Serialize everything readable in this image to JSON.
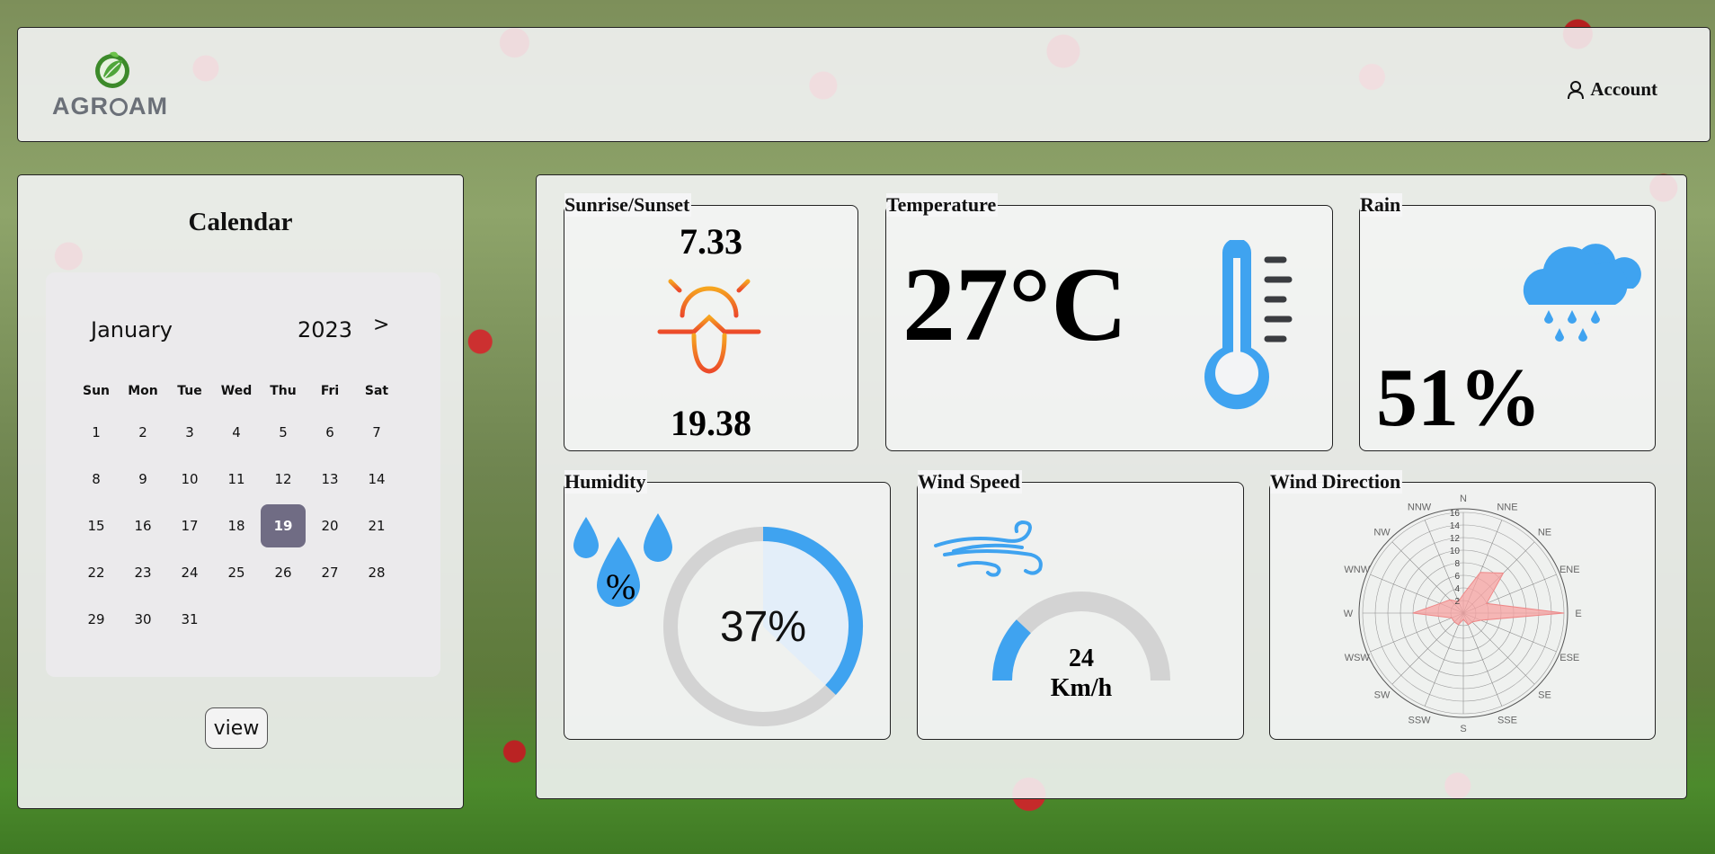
{
  "header": {
    "logo_text": "AGRAM",
    "logo_text_pre": "AGR",
    "logo_text_post": "AM",
    "account_label": "Account"
  },
  "calendar": {
    "title": "Calendar",
    "month": "January",
    "year": "2023",
    "next_label": ">",
    "weekdays": [
      "Sun",
      "Mon",
      "Tue",
      "Wed",
      "Thu",
      "Fri",
      "Sat"
    ],
    "days": [
      "1",
      "2",
      "3",
      "4",
      "5",
      "6",
      "7",
      "8",
      "9",
      "10",
      "11",
      "12",
      "13",
      "14",
      "15",
      "16",
      "17",
      "18",
      "19",
      "20",
      "21",
      "22",
      "23",
      "24",
      "25",
      "26",
      "27",
      "28",
      "29",
      "30",
      "31"
    ],
    "selected_day": "19",
    "view_label": "view"
  },
  "weather": {
    "sunrise": {
      "title": "Sunrise/Sunset",
      "sunrise_value": "7.33",
      "sunset_value": "19.38"
    },
    "temperature": {
      "title": "Temperature",
      "value": "27°C"
    },
    "rain": {
      "title": "Rain",
      "value": "51%"
    },
    "humidity": {
      "title": "Humidity",
      "icon_label": "%",
      "value": "37%",
      "fraction": 0.37
    },
    "wind_speed": {
      "title": "Wind Speed",
      "value": "24",
      "unit": "Km/h",
      "fraction": 0.24
    },
    "wind_direction": {
      "title": "Wind Direction",
      "directions": [
        "N",
        "NNE",
        "NE",
        "ENE",
        "E",
        "ESE",
        "SE",
        "SSE",
        "S",
        "SSW",
        "SW",
        "WSW",
        "W",
        "WNW",
        "NW",
        "NNW"
      ],
      "radial_ticks": [
        "2",
        "4",
        "6",
        "8",
        "10",
        "12",
        "14",
        "16"
      ],
      "values": [
        3,
        7,
        9,
        4,
        16,
        3,
        2,
        2,
        1,
        2,
        2,
        2,
        8,
        4,
        3,
        2
      ],
      "max": 16
    }
  },
  "colors": {
    "accent_blue": "#3fa3f0",
    "selected_day": "#706c84",
    "sun_orange": "#f29a1f",
    "rose_fill": "#f7a2a2"
  }
}
